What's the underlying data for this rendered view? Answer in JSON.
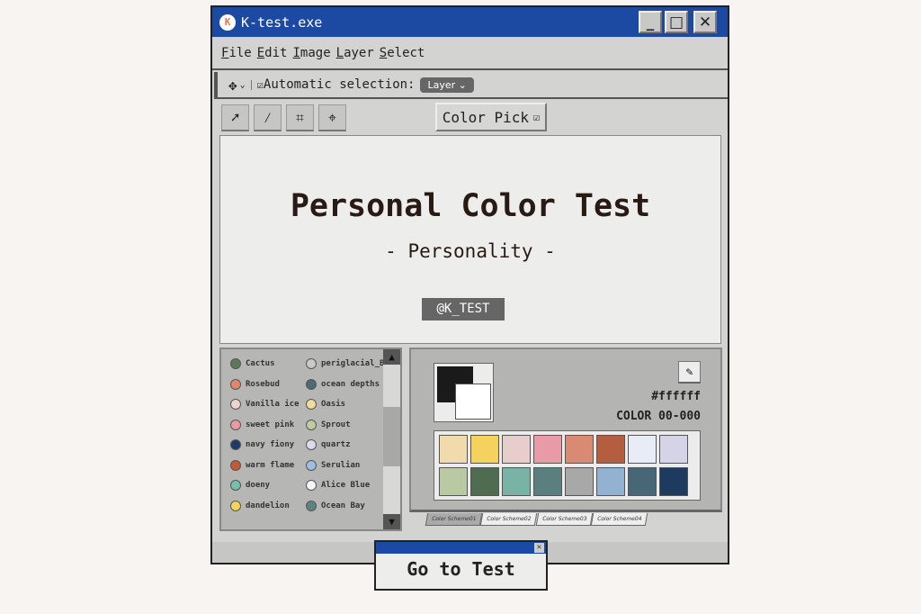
{
  "window": {
    "title": "K-test.exe",
    "logo_letter": "K",
    "minimize": "_",
    "maximize": "□",
    "close": "✕"
  },
  "menu": [
    "File",
    "Edit",
    "Image",
    "Layer",
    "Select"
  ],
  "toolbar": {
    "move_icon": "✥",
    "chevron": "⌄",
    "checkbox": "☑",
    "auto_label": "Automatic selection:",
    "layer_select": "Layer ⌄"
  },
  "tools": [
    {
      "icon": "arrow-icon",
      "glyph": "➚"
    },
    {
      "icon": "magic-wand-icon",
      "glyph": "⁄"
    },
    {
      "icon": "crop-icon",
      "glyph": "⌗"
    },
    {
      "icon": "target-icon",
      "glyph": "⌖"
    }
  ],
  "color_pick": {
    "label": "Color Pick",
    "checkbox": "☑"
  },
  "canvas": {
    "title": "Personal Color Test",
    "subtitle": "- Personality -",
    "handle": "@K_TEST"
  },
  "color_list": [
    {
      "name": "Cactus",
      "color": "#5b7a5c"
    },
    {
      "name": "periglacial_B",
      "color": "#c9ccc4"
    },
    {
      "name": "Rosebud",
      "color": "#e0896a"
    },
    {
      "name": "ocean depths",
      "color": "#4a6c78"
    },
    {
      "name": "Vanilla ice",
      "color": "#efd3cf"
    },
    {
      "name": "Oasis",
      "color": "#f0dc9e"
    },
    {
      "name": "sweet pink",
      "color": "#ec9aa2"
    },
    {
      "name": "Sprout",
      "color": "#c0cca0"
    },
    {
      "name": "navy fiony",
      "color": "#1e3b68"
    },
    {
      "name": "quartz",
      "color": "#dcdaee"
    },
    {
      "name": "warm flame",
      "color": "#c4593a"
    },
    {
      "name": "Serulian",
      "color": "#9dc0e0"
    },
    {
      "name": "doeny",
      "color": "#74bfae"
    },
    {
      "name": "Alice Blue",
      "color": "#f4f7fd"
    },
    {
      "name": "dandelion",
      "color": "#f6d55a"
    },
    {
      "name": "Ocean Bay",
      "color": "#5d8483"
    }
  ],
  "scroll": {
    "up": "▲",
    "down": "▼"
  },
  "picker": {
    "foreground": "#1a1a1a",
    "background": "#ffffff",
    "eyedropper": "✎",
    "hex": "#ffffff",
    "code": "COLOR 00-000"
  },
  "swatches": [
    "#f1dbac",
    "#f5d25e",
    "#e8cdcd",
    "#e89aa6",
    "#d98a72",
    "#b55d40",
    "#e8ecf6",
    "#d4d3e8",
    "#b9c9a3",
    "#4f6b50",
    "#79b3a6",
    "#5b7f7e",
    "#a7a8a7",
    "#93b2d2",
    "#476777",
    "#1e3a5e"
  ],
  "tabs": [
    "Color Scheme01",
    "Color Scheme02",
    "Color Scheme03",
    "Color Scheme04"
  ],
  "popup": {
    "close": "✕",
    "label": "Go to Test"
  }
}
